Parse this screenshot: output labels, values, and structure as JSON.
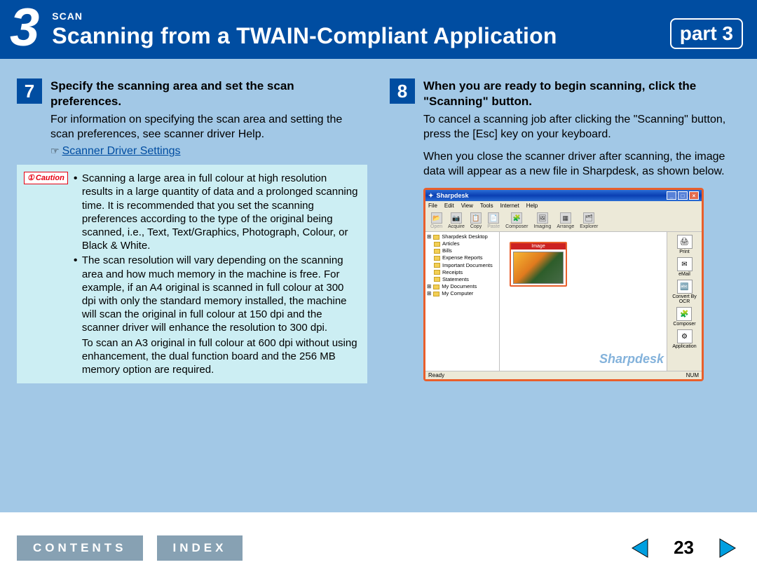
{
  "header": {
    "chapter_number": "3",
    "section_name": "SCAN",
    "title": "Scanning from a TWAIN-Compliant Application",
    "part_label": "part 3"
  },
  "step7": {
    "num": "7",
    "title": "Specify the scanning area and set the scan preferences.",
    "intro": "For information on specifying the scan area and setting the scan preferences, see scanner driver Help.",
    "link_icon": "☞",
    "link_text": "Scanner Driver Settings",
    "caution_icon": "①",
    "caution_label": "Caution",
    "caution_b1": "Scanning a large area in full colour at high resolution results in a large quantity of data and a prolonged scanning time. It is recommended that you set the scanning preferences according to the type of the original being scanned, i.e., Text, Text/Graphics, Photograph, Colour, or Black & White.",
    "caution_b2": "The scan resolution will vary depending on the scanning area and how much memory in the machine is free. For example, if an A4 original is scanned in full colour at 300 dpi with only the standard memory installed, the machine will scan the original in full colour at 150 dpi and the scanner driver will enhance the resolution to 300 dpi.",
    "caution_b2_cont": "To scan an A3 original in full colour at 600 dpi without using enhancement, the dual function board and the 256 MB memory option are required."
  },
  "step8": {
    "num": "8",
    "title": "When you are ready to begin scanning, click the \"Scanning\" button.",
    "p1": "To cancel a scanning job after clicking the \"Scanning\" button, press the [Esc] key on your keyboard.",
    "p2": "When you close the scanner driver after scanning, the image data will appear as a new file in Sharpdesk, as shown below."
  },
  "sharpdesk": {
    "title": "Sharpdesk",
    "menu": [
      "File",
      "Edit",
      "View",
      "Tools",
      "Internet",
      "Help"
    ],
    "toolbar": [
      {
        "label": "Open",
        "glyph": "📂",
        "disabled": true
      },
      {
        "label": "Acquire",
        "glyph": "📷",
        "disabled": false
      },
      {
        "label": "Copy",
        "glyph": "📋",
        "disabled": false
      },
      {
        "label": "Paste",
        "glyph": "📄",
        "disabled": true
      },
      {
        "label": "Composer",
        "glyph": "🧩",
        "disabled": false
      },
      {
        "label": "Imaging",
        "glyph": "🖼",
        "disabled": false
      },
      {
        "label": "Arrange",
        "glyph": "▦",
        "disabled": false
      },
      {
        "label": "Explorer",
        "glyph": "🗂",
        "disabled": false
      }
    ],
    "tree": [
      {
        "label": "Sharpdesk Desktop",
        "level": 0
      },
      {
        "label": "Articles",
        "level": 1
      },
      {
        "label": "Bills",
        "level": 1
      },
      {
        "label": "Expense Reports",
        "level": 1
      },
      {
        "label": "Important Documents",
        "level": 1
      },
      {
        "label": "Receipts",
        "level": 1
      },
      {
        "label": "Statements",
        "level": 1
      },
      {
        "label": "My Documents",
        "level": 0
      },
      {
        "label": "My Computer",
        "level": 0
      }
    ],
    "thumb_label": "Image",
    "sidebar": [
      {
        "label": "Print",
        "glyph": "🖨"
      },
      {
        "label": "eMail",
        "glyph": "✉"
      },
      {
        "label": "Convert By OCR",
        "glyph": "🔤"
      },
      {
        "label": "Composer",
        "glyph": "🧩"
      },
      {
        "label": "Application",
        "glyph": "⚙"
      }
    ],
    "status_left": "Ready",
    "status_right": "NUM",
    "watermark": "Sharpdesk"
  },
  "footer": {
    "contents": "CONTENTS",
    "index": "INDEX",
    "page_num": "23"
  },
  "colors": {
    "banner": "#004da1",
    "body_bg": "#a2c8e6",
    "caution_bg": "#cceef3",
    "caution_red": "#e60012",
    "highlight_orange": "#e95f2b",
    "footer_button": "#87a1b3",
    "nav_arrow": "#009fe0"
  }
}
